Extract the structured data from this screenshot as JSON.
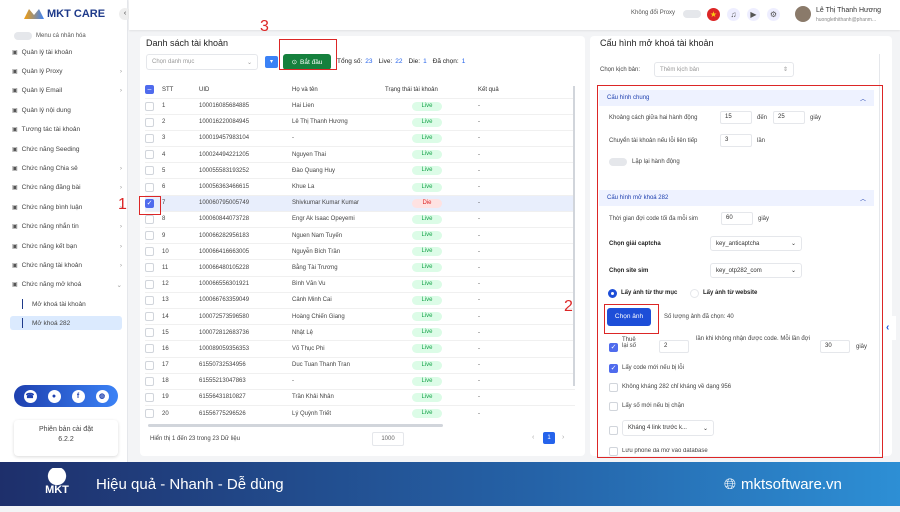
{
  "app": {
    "logo": "MKT CARE"
  },
  "sidebar": {
    "personal_menu": "Menu cá nhân hóa",
    "items": [
      {
        "label": "Quản lý tài khoản",
        "icon": "grid-icon",
        "chevron": false
      },
      {
        "label": "Quản lý Proxy",
        "icon": "proxy-icon",
        "chevron": true
      },
      {
        "label": "Quản lý Email",
        "icon": "email-icon",
        "chevron": true
      },
      {
        "label": "Quản lý nội dung",
        "icon": "content-icon",
        "chevron": false
      },
      {
        "label": "Tương tác tài khoản",
        "icon": "interact-icon",
        "chevron": false
      },
      {
        "label": "Chức năng Seeding",
        "icon": "seeding-icon",
        "chevron": false
      },
      {
        "label": "Chức năng Chia sẻ",
        "icon": "share-icon",
        "chevron": true
      },
      {
        "label": "Chức năng đăng bài",
        "icon": "post-icon",
        "chevron": true
      },
      {
        "label": "Chức năng bình luận",
        "icon": "comment-icon",
        "chevron": true
      },
      {
        "label": "Chức năng nhắn tin",
        "icon": "message-icon",
        "chevron": true
      },
      {
        "label": "Chức năng kết bạn",
        "icon": "friend-icon",
        "chevron": true
      },
      {
        "label": "Chức năng tài khoản",
        "icon": "account-icon",
        "chevron": true
      },
      {
        "label": "Chức năng mở khoá",
        "icon": "unlock-icon",
        "chevron": true
      }
    ],
    "sub_items": [
      {
        "label": "Mở khoá tài khoản",
        "active": false
      },
      {
        "label": "Mở khoá 282",
        "active": true
      }
    ],
    "version_label": "Phiên bản cài đặt",
    "version": "6.2.2"
  },
  "header": {
    "proxy_label": "Không đổi Proxy",
    "user_name": "Lê Thị Thanh Hương",
    "user_email": "huonglethithanh@phanm..."
  },
  "accounts": {
    "title": "Danh sách tài khoản",
    "category_placeholder": "Chọn danh mục",
    "start_label": "Bắt đầu",
    "stats": {
      "total_label": "Tổng số:",
      "total": "23",
      "live_label": "Live:",
      "live": "22",
      "die_label": "Die:",
      "die": "1",
      "selected_label": "Đã chọn:",
      "selected": "1"
    },
    "columns": [
      "STT",
      "UID",
      "Họ và tên",
      "Trạng thái tài khoản",
      "Kết quả"
    ],
    "rows": [
      [
        "1",
        "100016085684885",
        "Hai Lien",
        "Live",
        "-",
        false
      ],
      [
        "2",
        "100016220084945",
        "Lê Thị Thanh Hương",
        "Live",
        "-",
        false
      ],
      [
        "3",
        "100019457983104",
        "-",
        "Live",
        "-",
        false
      ],
      [
        "4",
        "100024494221205",
        "Nguyen Thai",
        "Live",
        "-",
        false
      ],
      [
        "5",
        "100055583193252",
        "Đào Quang Huy",
        "Live",
        "-",
        false
      ],
      [
        "6",
        "100056363466615",
        "Khue La",
        "Live",
        "-",
        false
      ],
      [
        "7",
        "100060795005749",
        "Shivkumar Kumar Kumar",
        "Die",
        "-",
        true
      ],
      [
        "8",
        "100060844073728",
        "Engr Ak Isaac Opeyemi",
        "Live",
        "-",
        false
      ],
      [
        "9",
        "100066282956183",
        "Nguen Nam Tuyến",
        "Live",
        "-",
        false
      ],
      [
        "10",
        "100066416663005",
        "Nguyễn Bích Trần",
        "Live",
        "-",
        false
      ],
      [
        "11",
        "100066480105228",
        "Bằng Tài Trương",
        "Live",
        "-",
        false
      ],
      [
        "12",
        "100066556301921",
        "Bình Văn Vu",
        "Live",
        "-",
        false
      ],
      [
        "13",
        "100066763359049",
        "Cảnh Minh Cai",
        "Live",
        "-",
        false
      ],
      [
        "14",
        "100072573596580",
        "Hoàng Chiến Giang",
        "Live",
        "-",
        false
      ],
      [
        "15",
        "100072812683736",
        "Nhật Lệ",
        "Live",
        "-",
        false
      ],
      [
        "16",
        "100089059356353",
        "Võ Thục Phi",
        "Live",
        "-",
        false
      ],
      [
        "17",
        "61550732534956",
        "Duc Tuan Thanh Tran",
        "Live",
        "-",
        false
      ],
      [
        "18",
        "61555213047863",
        "-",
        "Live",
        "-",
        false
      ],
      [
        "19",
        "61556431810827",
        "Trần Khải Nhân",
        "Live",
        "-",
        false
      ],
      [
        "20",
        "61556775296526",
        "Lý Quỳnh Triết",
        "Live",
        "-",
        false
      ]
    ],
    "footer": "Hiển thị 1 đến 23 trong 23 Dữ liệu",
    "page_size": "1000",
    "page": "1"
  },
  "config": {
    "title": "Cấu hình mở khoá tài khoản",
    "script_label": "Chọn kịch bản:",
    "script_placeholder": "Thêm kịch bản",
    "general": {
      "title": "Cấu hình chung",
      "interval_label": "Khoảng cách giữa hai hành động",
      "from": "15",
      "to_label": "đến",
      "to": "25",
      "unit_sec": "giây",
      "switch_label": "Chuyển tài khoản nếu lỗi liên tiếp",
      "switch_count": "3",
      "unit_times": "lần",
      "repeat_label": "Lặp lại hành động"
    },
    "unlock": {
      "title": "Cấu hình mở khoá 282",
      "wait_label": "Thời gian đợi code tối đa mỗi sim",
      "wait": "60",
      "unit_sec": "giây",
      "captcha_label": "Chọn giải captcha",
      "captcha": "key_anticaptcha",
      "sim_label": "Chọn site sim",
      "sim": "key_otp282_com",
      "radio_folder": "Lấy ảnh từ thư mục",
      "radio_web": "Lấy ảnh từ website",
      "pick_label": "Chọn ảnh",
      "picked_count": "Số lượng ảnh đã chọn: 40",
      "retry_label": "Thuê lại số",
      "retry": "2",
      "retry_mid": "lần khi không nhận được code. Mỗi lần đợi",
      "retry_wait": "30",
      "retry_unit": "giây",
      "new_code_label": "Lấy code mới nếu bị lỗi",
      "no_282_label": "Không kháng 282 chỉ kháng về dạng 956",
      "new_number_label": "Lấy số mới nếu bị chặn",
      "links_select": "Kháng 4 link trước k...",
      "save_phone_label": "Lưu phone đã mở vào database"
    }
  },
  "annotations": [
    "1",
    "2",
    "3"
  ],
  "banner": {
    "slogan": "Hiệu quả - Nhanh - Dễ dùng",
    "site": "mktsoftware.vn",
    "logo": "MKT"
  },
  "colors": {
    "primary": "#1d4ed8",
    "start": "#15803d",
    "annotation": "#dc2626",
    "banner": "#1e2f6b"
  }
}
